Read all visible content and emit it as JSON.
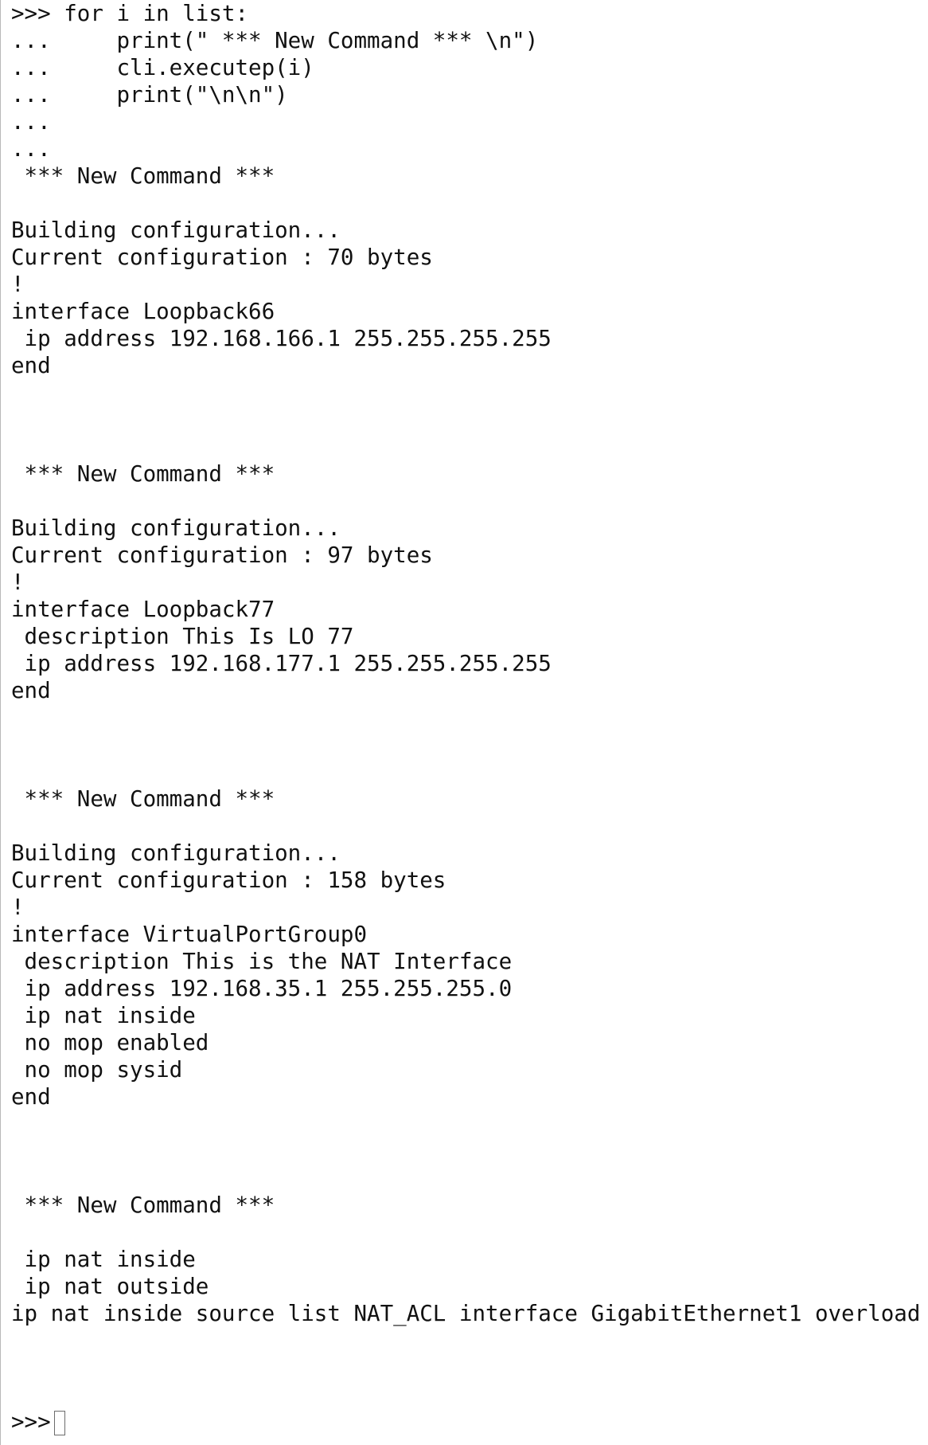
{
  "terminal": {
    "lines": [
      ">>> for i in list:",
      "...     print(\" *** New Command *** \\n\")",
      "...     cli.executep(i)",
      "...     print(\"\\n\\n\")",
      "...",
      "...",
      " *** New Command ***",
      "",
      "Building configuration...",
      "Current configuration : 70 bytes",
      "!",
      "interface Loopback66",
      " ip address 192.168.166.1 255.255.255.255",
      "end",
      "",
      "",
      "",
      " *** New Command ***",
      "",
      "Building configuration...",
      "Current configuration : 97 bytes",
      "!",
      "interface Loopback77",
      " description This Is LO 77",
      " ip address 192.168.177.1 255.255.255.255",
      "end",
      "",
      "",
      "",
      " *** New Command ***",
      "",
      "Building configuration...",
      "Current configuration : 158 bytes",
      "!",
      "interface VirtualPortGroup0",
      " description This is the NAT Interface",
      " ip address 192.168.35.1 255.255.255.0",
      " ip nat inside",
      " no mop enabled",
      " no mop sysid",
      "end",
      "",
      "",
      "",
      " *** New Command ***",
      "",
      " ip nat inside",
      " ip nat outside",
      "ip nat inside source list NAT_ACL interface GigabitEthernet1 overload",
      "",
      "",
      "",
      ">>>"
    ]
  }
}
